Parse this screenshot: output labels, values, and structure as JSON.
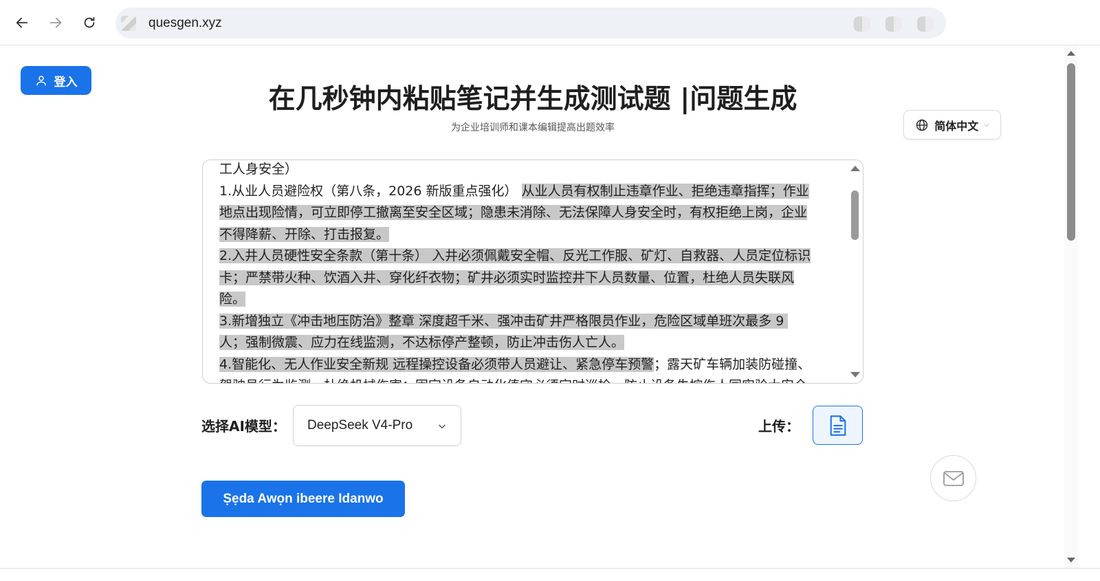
{
  "browser": {
    "url": "quesgen.xyz"
  },
  "header": {
    "login_label": "登入",
    "title": "在几秒钟内粘贴笔记并生成测试题 |问题生成",
    "subtitle": "为企业培训师和课本编辑提高出题效率",
    "language": "简体中文"
  },
  "editor": {
    "lines": [
      {
        "plain": "工人身安全）",
        "selected": ""
      },
      {
        "plain": "1.从业人员避险权（第八条，2026 新版重点强化） ",
        "selected": "从业人员有权制止违章作业、拒绝违章指挥；作业"
      },
      {
        "plain": "",
        "selected": "地点出现险情，可立即停工撤离至安全区域；隐患未消除、无法保障人身安全时，有权拒绝上岗，企业"
      },
      {
        "plain": "",
        "selected": "不得降薪、开除、打击报复。"
      },
      {
        "plain": "",
        "selected": "2.入井人员硬性安全条款（第十条） 入井必须佩戴安全帽、反光工作服、矿灯、自救器、人员定位标识"
      },
      {
        "plain": "",
        "selected": "卡；严禁带火种、饮酒入井、穿化纤衣物；矿井必须实时监控井下人员数量、位置，杜绝人员失联风"
      },
      {
        "plain": "",
        "selected": "险。"
      },
      {
        "plain": "",
        "selected": "3.新增独立《冲击地压防治》整章 深度超千米、强冲击矿井严格限员作业，危险区域单班次最多 9 "
      },
      {
        "plain": "",
        "selected": "人；强制微震、应力在线监测，不达标停产整顿，防止冲击伤人亡人。"
      },
      {
        "plain": "；露天矿车辆加装防碰撞、",
        "selected": "4.智能化、无人作业安全新规 远程操控设备必须带人员避让、紧急停车预警"
      },
      {
        "plain": "驾驶员行为监测，杜绝机械伤害；固定设备自动化值守必须定时巡检，防止设备失控伤人同实验大安全",
        "selected": ""
      }
    ]
  },
  "controls": {
    "model_label": "选择AI模型：",
    "model_value": "DeepSeek V4-Pro",
    "upload_label": "上传：",
    "generate_label": "Ṣẹda Awọn ibeere Idanwo"
  },
  "colors": {
    "accent": "#1a73e8",
    "selection": "#c8c8c8"
  },
  "icons": {
    "back": "arrow-left-icon",
    "forward": "arrow-right-icon",
    "reload": "reload-icon",
    "user": "user-icon",
    "globe": "globe-icon",
    "file": "file-icon",
    "mail": "mail-icon"
  }
}
